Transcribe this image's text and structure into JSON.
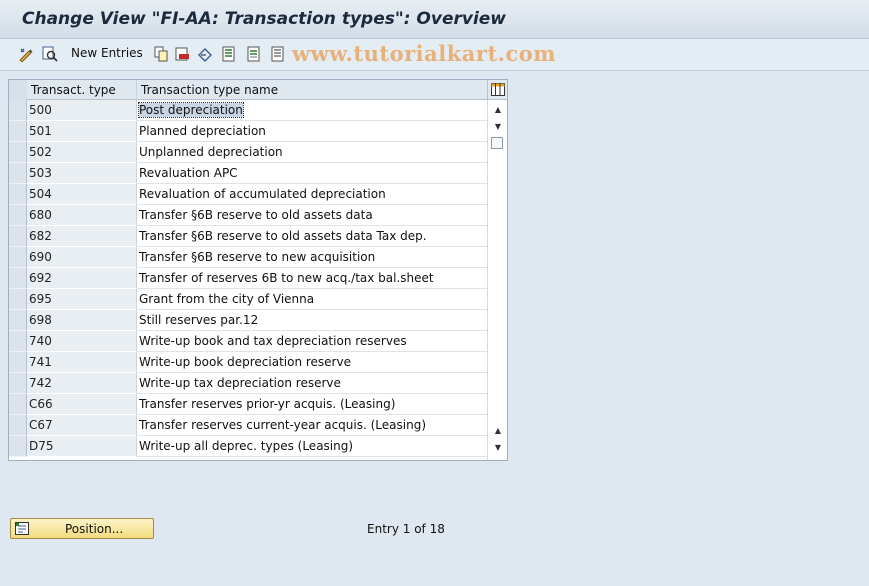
{
  "title": "Change View \"FI-AA: Transaction types\": Overview",
  "toolbar": {
    "new_entries_label": "New Entries",
    "icons": [
      "display-change-icon",
      "select-icon",
      "copy-icon",
      "delete-icon",
      "undo-icon",
      "select-all-icon",
      "select-block-icon",
      "deselect-all-icon"
    ]
  },
  "watermark": "www.tutorialkart.com",
  "table": {
    "columns": [
      "Transact. type",
      "Transaction type name"
    ],
    "rows": [
      {
        "type": "500",
        "name": "Post depreciation"
      },
      {
        "type": "501",
        "name": "Planned depreciation"
      },
      {
        "type": "502",
        "name": "Unplanned depreciation"
      },
      {
        "type": "503",
        "name": "Revaluation APC"
      },
      {
        "type": "504",
        "name": "Revaluation of accumulated depreciation"
      },
      {
        "type": "680",
        "name": "Transfer §6B reserve to old assets data"
      },
      {
        "type": "682",
        "name": "Transfer §6B reserve to old assets data  Tax dep."
      },
      {
        "type": "690",
        "name": "Transfer §6B reserve to new acquisition"
      },
      {
        "type": "692",
        "name": "Transfer of reserves 6B to new acq./tax bal.sheet"
      },
      {
        "type": "695",
        "name": "Grant from the city of Vienna"
      },
      {
        "type": "698",
        "name": "Still reserves par.12"
      },
      {
        "type": "740",
        "name": "Write-up book and tax depreciation reserves"
      },
      {
        "type": "741",
        "name": "Write-up book depreciation reserve"
      },
      {
        "type": "742",
        "name": "Write-up tax depreciation reserve"
      },
      {
        "type": "C66",
        "name": "Transfer reserves prior-yr acquis. (Leasing)"
      },
      {
        "type": "C67",
        "name": "Transfer reserves current-year acquis. (Leasing)"
      },
      {
        "type": "D75",
        "name": "Write-up all deprec. types (Leasing)"
      }
    ]
  },
  "footer": {
    "position_button_label": "Position...",
    "entry_text": "Entry 1 of 18"
  },
  "colors": {
    "background": "#dfe8f1",
    "key_column": "#e9eef3",
    "button": "#f2dc7e"
  }
}
